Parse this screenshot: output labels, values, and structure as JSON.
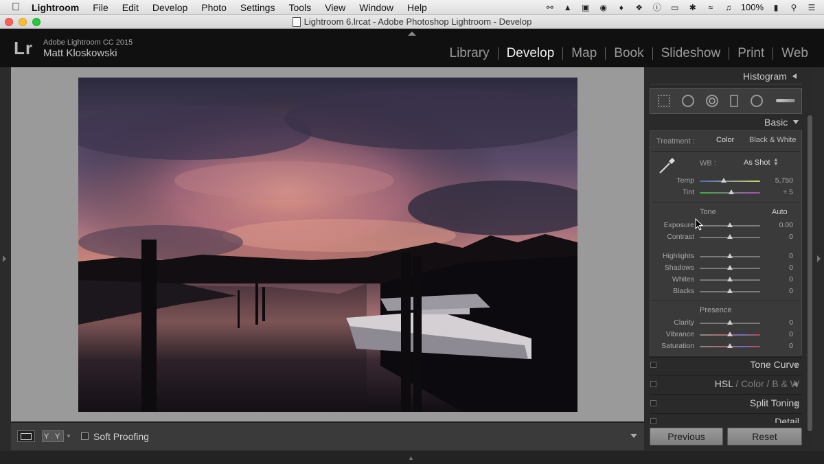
{
  "menubar": {
    "app": "Lightroom",
    "items": [
      "File",
      "Edit",
      "Develop",
      "Photo",
      "Settings",
      "Tools",
      "View",
      "Window",
      "Help"
    ],
    "battery": "100%"
  },
  "window": {
    "title": "Lightroom 6.lrcat - Adobe Photoshop Lightroom - Develop"
  },
  "identity": {
    "logo": "Lr",
    "product": "Adobe Lightroom CC 2015",
    "user": "Matt Kloskowski"
  },
  "modules": [
    "Library",
    "Develop",
    "Map",
    "Book",
    "Slideshow",
    "Print",
    "Web"
  ],
  "active_module": "Develop",
  "toolbar": {
    "soft_proofing": "Soft Proofing",
    "compare_label": "Y Y"
  },
  "panels": {
    "histogram": "Histogram",
    "basic": "Basic",
    "treatment_label": "Treatment :",
    "treatment_color": "Color",
    "treatment_bw": "Black & White",
    "wb_label": "WB :",
    "wb_value": "As Shot",
    "tone_label": "Tone",
    "auto": "Auto",
    "presence_label": "Presence",
    "tone_curve": "Tone Curve",
    "hsl": "HSL",
    "hsl_sep1": "/",
    "hsl_color": "Color",
    "hsl_sep2": "/",
    "hsl_bw": "B & W",
    "split_toning": "Split Toning",
    "detail": "Detail"
  },
  "sliders": {
    "temp": {
      "label": "Temp",
      "value": "5,750",
      "pos": 0.4
    },
    "tint": {
      "label": "Tint",
      "value": "+ 5",
      "pos": 0.52
    },
    "exposure": {
      "label": "Exposure",
      "value": "0.00",
      "pos": 0.5
    },
    "contrast": {
      "label": "Contrast",
      "value": "0",
      "pos": 0.5
    },
    "highlights": {
      "label": "Highlights",
      "value": "0",
      "pos": 0.5
    },
    "shadows": {
      "label": "Shadows",
      "value": "0",
      "pos": 0.5
    },
    "whites": {
      "label": "Whites",
      "value": "0",
      "pos": 0.5
    },
    "blacks": {
      "label": "Blacks",
      "value": "0",
      "pos": 0.5
    },
    "clarity": {
      "label": "Clarity",
      "value": "0",
      "pos": 0.5
    },
    "vibrance": {
      "label": "Vibrance",
      "value": "0",
      "pos": 0.5
    },
    "saturation": {
      "label": "Saturation",
      "value": "0",
      "pos": 0.5
    }
  },
  "buttons": {
    "previous": "Previous",
    "reset": "Reset"
  },
  "colors": {
    "panel_bg": "#3a3a3a",
    "canvas_bg": "#9a9a9a",
    "active_module": "#f0f0f0"
  }
}
